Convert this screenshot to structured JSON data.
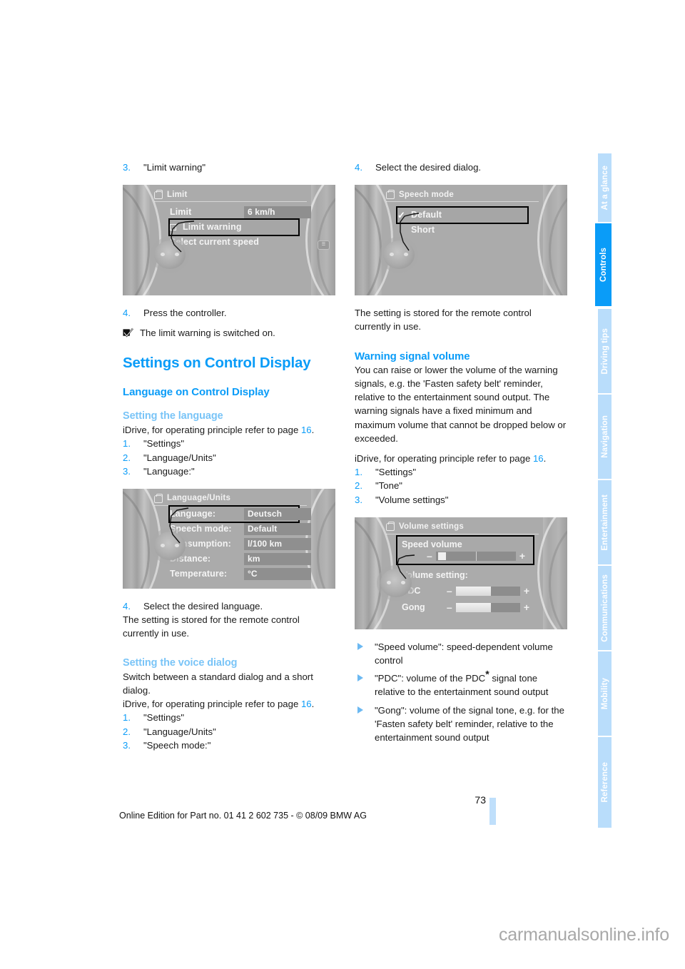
{
  "document": {
    "page_number": "73",
    "footer_note": "Online Edition for Part no. 01 41 2 602 735 - © 08/09 BMW AG",
    "watermark": "carmanualsonline.info"
  },
  "colors": {
    "accent_blue": "#0a9cf8",
    "light_blue": "#79c4f7",
    "tab_inactive": "#b9ddfb",
    "tab_active": "#0a9cf8",
    "footer_bar": "#bfdffb"
  },
  "sidebar": {
    "tabs": [
      {
        "label": "At a glance",
        "active": false
      },
      {
        "label": "Controls",
        "active": true
      },
      {
        "label": "Driving tips",
        "active": false
      },
      {
        "label": "Navigation",
        "active": false
      },
      {
        "label": "Entertainment",
        "active": false
      },
      {
        "label": "Communications",
        "active": false
      },
      {
        "label": "Mobility",
        "active": false
      },
      {
        "label": "Reference",
        "active": false
      }
    ]
  },
  "left_column": {
    "step3": {
      "num": "3.",
      "text": "\"Limit warning\""
    },
    "figure_limit": {
      "title": "Limit",
      "rows": [
        {
          "label": "Limit",
          "value": "6 km/h"
        },
        {
          "label": "Limit warning",
          "value": "",
          "selected": true,
          "checkbox": true
        },
        {
          "label": "Select current speed",
          "value": ""
        }
      ]
    },
    "step4": {
      "num": "4.",
      "text": "Press the controller."
    },
    "note": "The limit warning is switched on.",
    "section_title": "Settings on Control Display",
    "subsection_title": "Language on Control Display",
    "sub_language": {
      "heading": "Setting the language",
      "intro_before": "iDrive, for operating principle refer to page ",
      "intro_pageref": "16",
      "intro_after": ".",
      "steps": [
        {
          "num": "1.",
          "text": "\"Settings\""
        },
        {
          "num": "2.",
          "text": "\"Language/Units\""
        },
        {
          "num": "3.",
          "text": "\"Language:\""
        }
      ]
    },
    "figure_language": {
      "title": "Language/Units",
      "rows": [
        {
          "label": "Language:",
          "value": "Deutsch",
          "selected": true
        },
        {
          "label": "Speech mode:",
          "value": "Default"
        },
        {
          "label": "Consumption:",
          "value": "l/100 km"
        },
        {
          "label": "Distance:",
          "value": "km"
        },
        {
          "label": "Temperature:",
          "value": "°C"
        }
      ]
    },
    "step4b": {
      "num": "4.",
      "text": "Select the desired language."
    },
    "stored_note": "The setting is stored for the remote control currently in use.",
    "sub_voice": {
      "heading": "Setting the voice dialog",
      "intro": "Switch between a standard dialog and a short dialog.",
      "intro2_before": "iDrive, for operating principle refer to page ",
      "intro2_pageref": "16",
      "intro2_after": ".",
      "steps": [
        {
          "num": "1.",
          "text": "\"Settings\""
        },
        {
          "num": "2.",
          "text": "\"Language/Units\""
        },
        {
          "num": "3.",
          "text": "\"Speech mode:\""
        }
      ]
    }
  },
  "right_column": {
    "step4": {
      "num": "4.",
      "text": "Select the desired dialog."
    },
    "figure_speech": {
      "title": "Speech mode",
      "rows": [
        {
          "label": "Default",
          "selected": true,
          "check": true
        },
        {
          "label": "Short",
          "selected": false
        }
      ]
    },
    "stored_note": "The setting is stored for the remote control currently in use.",
    "warning_section": {
      "heading": "Warning signal volume",
      "paragraph": "You can raise or lower the volume of the warning signals, e.g. the 'Fasten safety belt' reminder, relative to the entertainment sound output. The warning signals have a fixed minimum and maximum volume that cannot be dropped below or exceeded.",
      "intro_before": "iDrive, for operating principle refer to page ",
      "intro_pageref": "16",
      "intro_after": ".",
      "steps": [
        {
          "num": "1.",
          "text": "\"Settings\""
        },
        {
          "num": "2.",
          "text": "\"Tone\""
        },
        {
          "num": "3.",
          "text": "\"Volume settings\""
        }
      ]
    },
    "figure_volume": {
      "title": "Volume settings",
      "speed_volume_label": "Speed volume",
      "volume_setting_label": "Volume setting:",
      "sliders": [
        {
          "label": "",
          "minus": "–",
          "plus": "+",
          "fill_percent": 12
        },
        {
          "label": "PDC",
          "minus": "–",
          "plus": "+",
          "fill_percent": 55
        },
        {
          "label": "Gong",
          "minus": "–",
          "plus": "+",
          "fill_percent": 55
        }
      ]
    },
    "bullets": [
      {
        "text": "\"Speed volume\": speed-dependent volume control"
      },
      {
        "text_part1": "\"PDC\": volume of the PDC",
        "asterisk": "*",
        "text_part2": " signal tone relative to the entertainment sound output"
      },
      {
        "text": "\"Gong\": volume of the signal tone, e.g. for the 'Fasten safety belt' reminder, relative to the entertainment sound output"
      }
    ]
  }
}
